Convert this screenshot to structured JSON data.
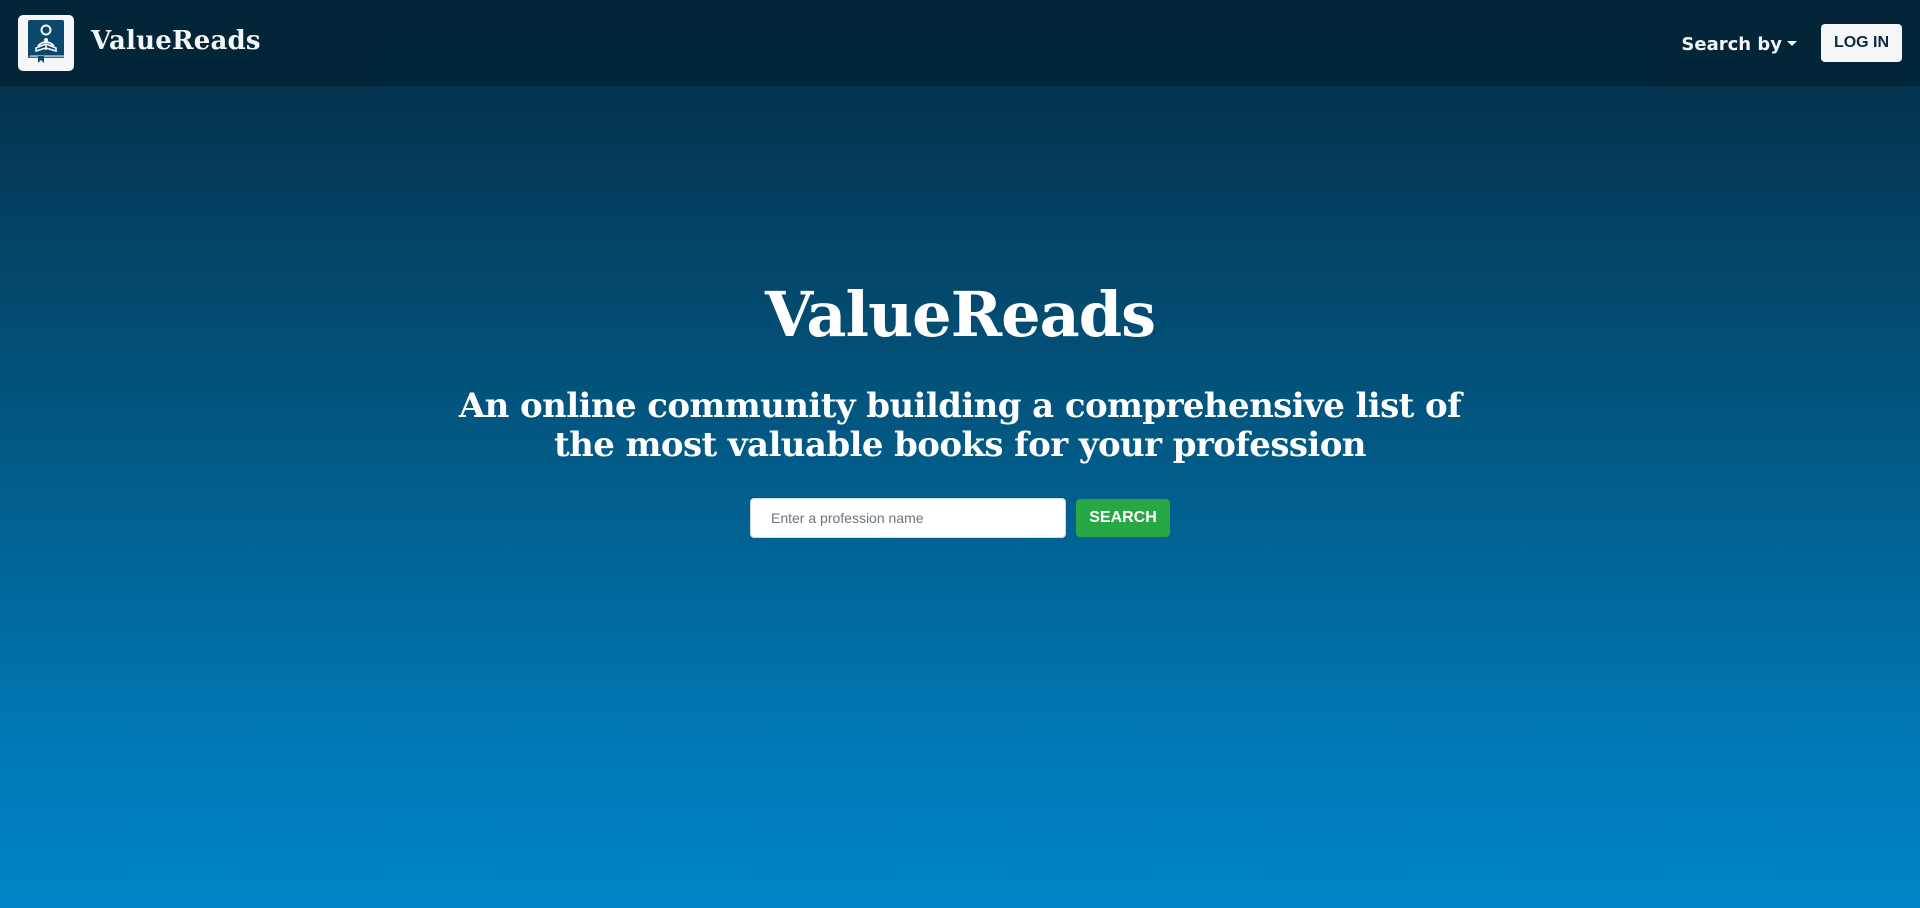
{
  "navbar": {
    "brand_name": "ValueReads",
    "logo_icon": "book-reader-logo-icon",
    "search_by_label": "Search by",
    "login_label": "LOG IN"
  },
  "hero": {
    "title": "ValueReads",
    "subtitle": "An online community building a comprehensive list of the most valuable books for your profession"
  },
  "search": {
    "placeholder": "Enter a profession name",
    "value": "",
    "button_label": "SEARCH"
  },
  "colors": {
    "navbar_bg": "#022538",
    "gradient_top": "#032a41",
    "gradient_bottom": "#0086c8",
    "search_button": "#28a745",
    "logo_blue": "#0c4a6e"
  }
}
